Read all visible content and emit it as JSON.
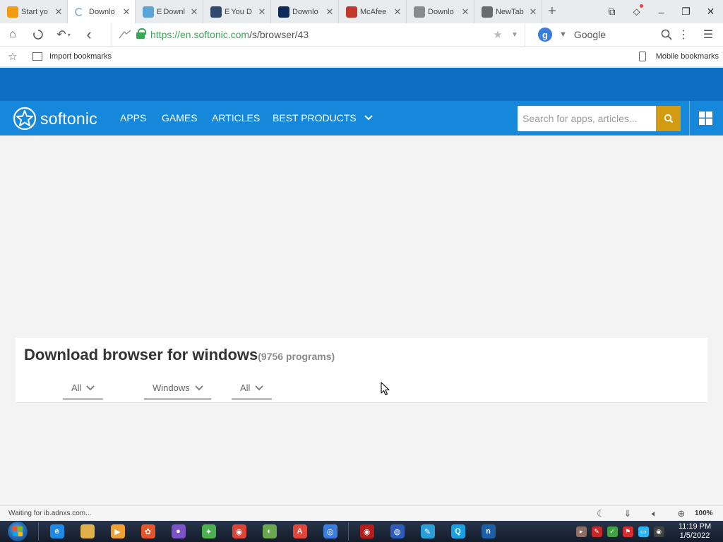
{
  "browser": {
    "tabs": [
      {
        "label": "Start yo",
        "icon": "orange-play-icon",
        "color": "#f39c12",
        "active": false
      },
      {
        "label": "Downlo",
        "icon": "loading-spinner-icon",
        "color": "#9fb7cc",
        "active": true
      },
      {
        "label": "Downl",
        "icon": "globe-icon",
        "color": "#5aa5d6",
        "prefix": "E",
        "active": false
      },
      {
        "label": "You D",
        "icon": "earth-icon",
        "color": "#2f4a6e",
        "prefix": "E",
        "active": false
      },
      {
        "label": "Downlo",
        "icon": "photoshop-icon",
        "color": "#0b2a5b",
        "active": false
      },
      {
        "label": "McAfee",
        "icon": "mcafee-icon",
        "color": "#c0392b",
        "active": false
      },
      {
        "label": "Downlo",
        "icon": "download-page-icon",
        "color": "#8a8a8a",
        "active": false
      },
      {
        "label": "NewTab",
        "icon": "newtab-grid-icon",
        "color": "#6b6b6b",
        "active": false
      }
    ],
    "new_tab_symbol": "+",
    "window_controls": {
      "reader": "⧉",
      "extension": "⬦",
      "minimize": "–",
      "restore": "❐",
      "close": "✕"
    },
    "nav": {
      "home": "⌂",
      "stop": "✕",
      "undo": "↶",
      "back": "‹"
    },
    "url": {
      "scheme_host": "https://en.softonic.com",
      "path": "/s/browser/43"
    },
    "search_engine": {
      "letter": "g",
      "name": "Google"
    },
    "bookmarks_bar": {
      "import_label": "Import bookmarks",
      "mobile_label": "Mobile bookmarks"
    },
    "status": {
      "text": "Waiting for ib.adnxs.com...",
      "zoom": "100%"
    }
  },
  "site": {
    "brand": "softonic",
    "nav_links": [
      "APPS",
      "GAMES",
      "ARTICLES",
      "BEST PRODUCTS"
    ],
    "search_placeholder": "Search for apps, articles...",
    "colors": {
      "top_band": "#0c6dc2",
      "nav_bg": "#1588dc",
      "search_button": "#d39b12"
    },
    "page_title": "Download browser for windows",
    "program_count": "(9756 programs)",
    "filters": [
      {
        "label": "All"
      },
      {
        "label": "Windows"
      },
      {
        "label": "All"
      }
    ]
  },
  "taskbar": {
    "apps": [
      {
        "icon": "internet-explorer-icon",
        "color": "#1e88e5",
        "glyph": "e"
      },
      {
        "icon": "file-explorer-icon",
        "color": "#e0b04a",
        "glyph": ""
      },
      {
        "icon": "media-player-icon",
        "color": "#f0a030",
        "glyph": "▶"
      },
      {
        "icon": "app-red-icon",
        "color": "#e5562b",
        "glyph": "✿"
      },
      {
        "icon": "colorful-app-icon",
        "color": "#7b52c7",
        "glyph": "●"
      },
      {
        "icon": "colorful-app-2-icon",
        "color": "#4caf50",
        "glyph": "✦"
      },
      {
        "icon": "chrome-icon",
        "color": "#db4437",
        "glyph": "◉"
      },
      {
        "icon": "green-app-icon",
        "color": "#6aa84f",
        "glyph": "◐"
      },
      {
        "icon": "red-a-icon",
        "color": "#e0463b",
        "glyph": "A"
      },
      {
        "icon": "browser-blue-icon",
        "color": "#3b7ddd",
        "glyph": "◎"
      }
    ],
    "apps_right": [
      {
        "icon": "red-circle-icon",
        "color": "#b71c1c",
        "glyph": "◉"
      },
      {
        "icon": "firefox-blue-icon",
        "color": "#2e5cb8",
        "glyph": "◍"
      },
      {
        "icon": "tool-icon",
        "color": "#2a9fd6",
        "glyph": "✎"
      },
      {
        "icon": "q-browser-icon",
        "color": "#1aa0e0",
        "glyph": "Q"
      },
      {
        "icon": "n-app-icon",
        "color": "#1b5fa8",
        "glyph": "n"
      }
    ],
    "tray": [
      {
        "icon": "tray-app-icon",
        "color": "#8d6e63",
        "glyph": "▸"
      },
      {
        "icon": "pdf-icon",
        "color": "#c62828",
        "glyph": "✎"
      },
      {
        "icon": "shield-check-icon",
        "color": "#43a047",
        "glyph": "✓"
      },
      {
        "icon": "flag-icon",
        "color": "#d32f2f",
        "glyph": "⚑"
      },
      {
        "icon": "monitor-icon",
        "color": "#29b6f6",
        "glyph": "▭"
      },
      {
        "icon": "record-icon",
        "color": "#424242",
        "glyph": "◉"
      }
    ],
    "clock": {
      "time": "11:19 PM",
      "date": "1/5/2022"
    }
  }
}
